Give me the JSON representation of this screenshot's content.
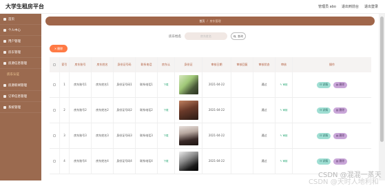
{
  "app": {
    "title": "大学生租房平台"
  },
  "topbar": {
    "user": "管理员 abo",
    "exit_front": "退出到前台",
    "logout": "退出登录"
  },
  "sidebar": {
    "items": [
      {
        "label": "首页"
      },
      {
        "label": "个人中心"
      },
      {
        "label": "用户管理"
      },
      {
        "label": "房东管理"
      },
      {
        "label": "房源信息管理"
      },
      {
        "label": "房东认证",
        "sub": true
      },
      {
        "label": "房源新闻管理"
      },
      {
        "label": "订单信息管理"
      },
      {
        "label": "系统管理"
      }
    ]
  },
  "breadcrumb": {
    "home": "首页",
    "sep": "/",
    "current": "房东管理"
  },
  "search": {
    "label": "房东姓名",
    "placeholder": "房东姓名",
    "button": "查询"
  },
  "toolbar": {
    "delete": "删除"
  },
  "table": {
    "headers": [
      "索引",
      "房东账号",
      "房东姓名",
      "身份证号码",
      "联系电话",
      "房东认",
      "身份证",
      "审核日期",
      "审核回复",
      "审核状态",
      "审核",
      "操作"
    ],
    "rows": [
      {
        "idx": "1",
        "account": "房东账号1",
        "name": "房东姓名1",
        "idcard": "身份证号码1",
        "phone": "联系电话1",
        "auth": "下载",
        "date": "2021-04-22",
        "reply": "",
        "status": "通过",
        "audit": "审核"
      },
      {
        "idx": "2",
        "account": "房东账号2",
        "name": "房东姓名2",
        "idcard": "身份证号码2",
        "phone": "联系电话2",
        "auth": "下载",
        "date": "2021-04-22",
        "reply": "",
        "status": "通过",
        "audit": "审核"
      },
      {
        "idx": "3",
        "account": "房东账号3",
        "name": "房东姓名3",
        "idcard": "身份证号码3",
        "phone": "联系电话3",
        "auth": "下载",
        "date": "2021-04-22",
        "reply": "",
        "status": "通过",
        "audit": "审核"
      },
      {
        "idx": "4",
        "account": "房东账号4",
        "name": "房东姓名4",
        "idcard": "身份证号码4",
        "phone": "联系电话4",
        "auth": "下载",
        "date": "2021-04-22",
        "reply": "",
        "status": "通过",
        "audit": "审核"
      }
    ],
    "actions": {
      "detail": "详情",
      "delete": "删除"
    }
  },
  "watermark": {
    "line1": "CSDN @混混一蒸天",
    "line2": "CSDN @天时人地利和"
  }
}
